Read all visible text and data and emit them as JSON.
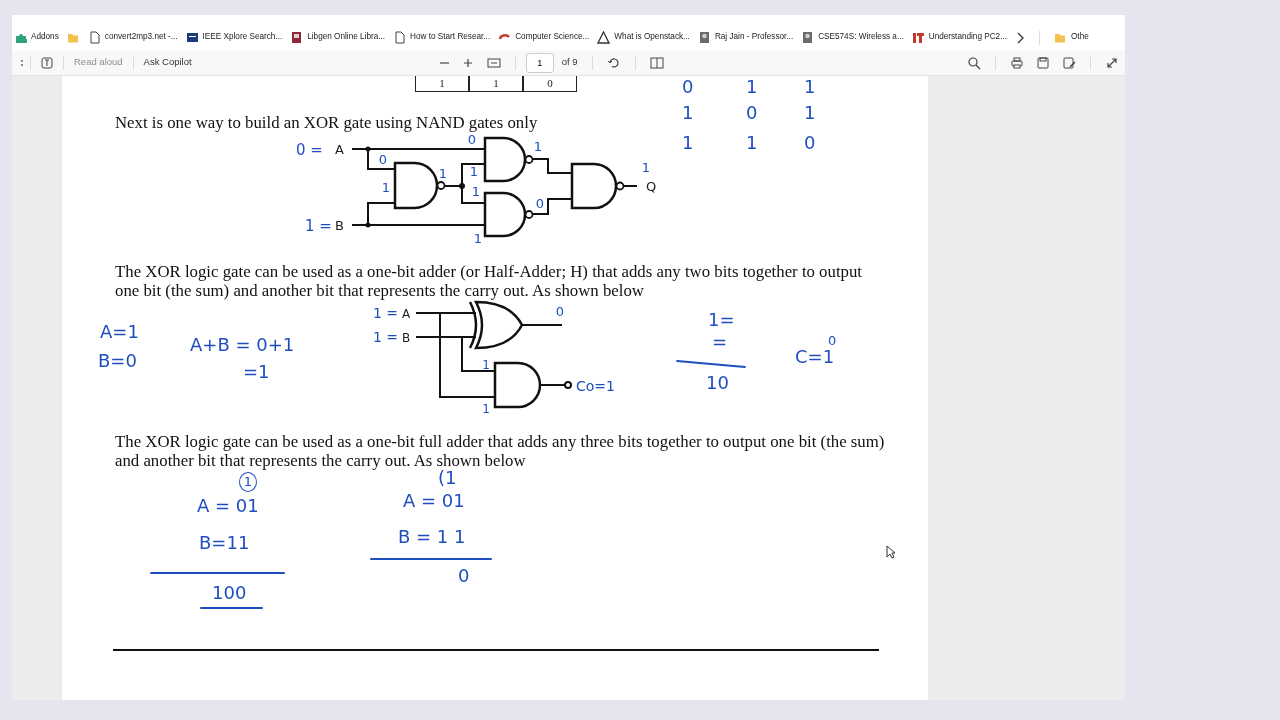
{
  "bookmarks": [
    {
      "label": "Addons",
      "kind": "link"
    },
    {
      "kind": "folder"
    },
    {
      "label": "convert2mp3.net -...",
      "kind": "link"
    },
    {
      "label": "IEEE Xplore Search...",
      "kind": "link"
    },
    {
      "label": "Libgen Online Libra...",
      "kind": "link"
    },
    {
      "label": "How to Start Resear...",
      "kind": "link"
    },
    {
      "label": "Computer Science...",
      "kind": "link"
    },
    {
      "label": "What is Openstack...",
      "kind": "link"
    },
    {
      "label": "Raj Jain - Professor...",
      "kind": "link"
    },
    {
      "label": "CSE574S: Wireless a...",
      "kind": "link"
    },
    {
      "label": "Understanding PC2...",
      "kind": "link"
    },
    {
      "label": "Othe",
      "kind": "folder"
    }
  ],
  "pdf_toolbar": {
    "read_aloud": {
      "label": "Read aloud",
      "disabled": true
    },
    "ask_copilot": "Ask Copilot",
    "page_input": "1",
    "page_count": "of 9"
  },
  "page": {
    "table_fragment": [
      "1",
      "1",
      "0"
    ],
    "truth_table_notes": [
      [
        "0",
        "1",
        "1"
      ],
      [
        "1",
        "0",
        "1"
      ],
      [
        "1",
        "1",
        "0"
      ]
    ],
    "intro_text": "Next is one way to build an XOR gate using NAND gates only",
    "xor_nand_diagram": {
      "input_a_note": "0 =",
      "input_a": "A",
      "input_b_note": "1 =",
      "input_b": "B",
      "output": "Q",
      "bit_notes": [
        "0",
        "1",
        "1",
        "0",
        "1",
        "1",
        "1",
        "0",
        "1",
        "1"
      ]
    },
    "half_adder_text": "The XOR logic gate can be used as a one-bit adder (or Half-Adder; H) that adds any two bits together to output one bit (the sum) and another bit that represents the carry out. As shown below",
    "half_adder_diagram": {
      "input_a_note": "1 =",
      "input_a": "A",
      "input_b_note": "1 =",
      "input_b": "B",
      "sum_note": "0",
      "carry_output": "Co=1",
      "bit_notes": [
        "1",
        "1"
      ]
    },
    "half_adder_notes": [
      "A=1",
      "B=0",
      "A+B = 0+1",
      "=1",
      "1=",
      "=",
      "10",
      "C=1",
      "0"
    ],
    "full_adder_text": "The XOR logic gate can be used as a one-bit full adder that adds any three bits together to output one bit (the sum) and another bit that represents the carry out. As shown below",
    "full_adder_notes": [
      {
        "text": "1",
        "circled": true
      },
      {
        "text": "A = 01",
        "circled": false
      },
      {
        "text": "B=11",
        "circled": false
      },
      {
        "text": "100",
        "circled": false
      },
      {
        "text": "(1",
        "circled": false
      },
      {
        "text": "A = 01",
        "circled": false
      },
      {
        "text": "B = 1 1",
        "circled": false
      },
      {
        "text": "0",
        "circled": false
      }
    ]
  }
}
